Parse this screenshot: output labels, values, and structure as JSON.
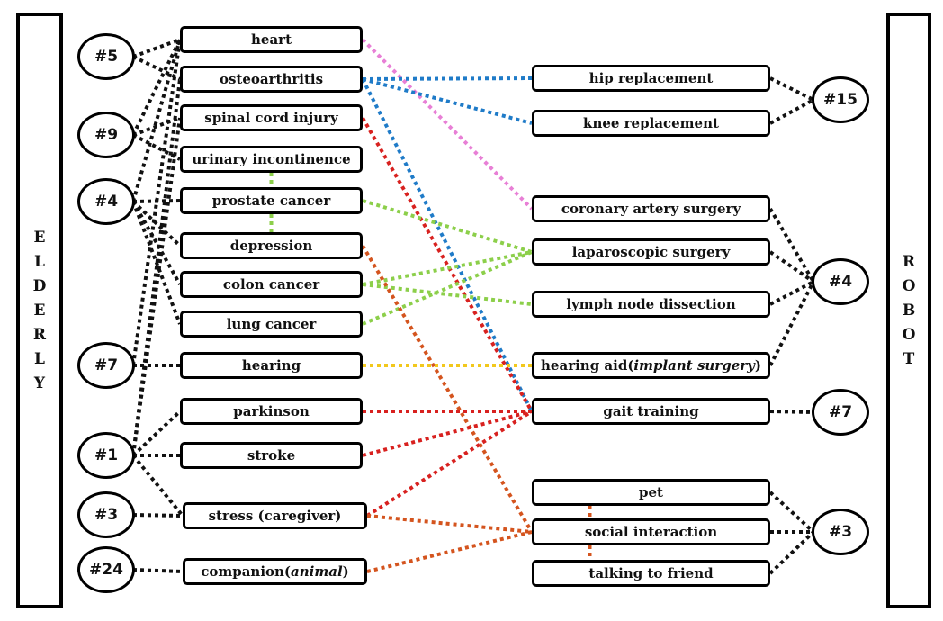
{
  "sidebars": {
    "left": {
      "label": "ELDERLY",
      "letters": [
        "E",
        "L",
        "D",
        "E",
        "R",
        "L",
        "Y"
      ]
    },
    "right": {
      "label": "ROBOT",
      "letters": [
        "R",
        "O",
        "B",
        "O",
        "T"
      ]
    }
  },
  "colors": {
    "black": "#111111",
    "pink": "#e87fd6",
    "blue": "#1f7bc8",
    "red": "#d8211f",
    "green": "#8ccf4a",
    "yellow": "#f2c81c",
    "orange": "#d4541e"
  },
  "left_counts": [
    {
      "id": "c5",
      "label": "#5"
    },
    {
      "id": "c9",
      "label": "#9"
    },
    {
      "id": "c4",
      "label": "#4"
    },
    {
      "id": "c7",
      "label": "#7"
    },
    {
      "id": "c1",
      "label": "#1"
    },
    {
      "id": "c3",
      "label": "#3"
    },
    {
      "id": "c24",
      "label": "#24"
    }
  ],
  "conditions": [
    {
      "id": "heart",
      "label": "heart"
    },
    {
      "id": "osteo",
      "label": "osteoarthritis"
    },
    {
      "id": "spinal",
      "label": "spinal cord injury"
    },
    {
      "id": "urinary",
      "label": "urinary incontinence"
    },
    {
      "id": "prostate",
      "label": "prostate cancer"
    },
    {
      "id": "depression",
      "label": "depression"
    },
    {
      "id": "colon",
      "label": "colon cancer"
    },
    {
      "id": "lung",
      "label": "lung cancer"
    },
    {
      "id": "hearing",
      "label": "hearing"
    },
    {
      "id": "parkinson",
      "label": "parkinson"
    },
    {
      "id": "stroke",
      "label": "stroke"
    },
    {
      "id": "stress",
      "label": "stress (caregiver)"
    },
    {
      "id": "companion",
      "label": "companion(",
      "label_italic": "animal",
      "label_suffix": ")"
    }
  ],
  "robot_apps": [
    {
      "id": "hip",
      "label": "hip replacement"
    },
    {
      "id": "knee",
      "label": "knee replacement"
    },
    {
      "id": "coronary",
      "label": "coronary artery surgery"
    },
    {
      "id": "lap",
      "label": "laparoscopic surgery"
    },
    {
      "id": "lymph",
      "label": "lymph node dissection"
    },
    {
      "id": "hearaid",
      "label": "hearing aid(",
      "label_italic": "implant surgery",
      "label_suffix": ")"
    },
    {
      "id": "gait",
      "label": "gait training"
    },
    {
      "id": "pet",
      "label": "pet"
    },
    {
      "id": "social",
      "label": "social interaction"
    },
    {
      "id": "talking",
      "label": "talking to friend"
    }
  ],
  "right_counts": [
    {
      "id": "r15",
      "label": "#15"
    },
    {
      "id": "r4",
      "label": "#4"
    },
    {
      "id": "r7",
      "label": "#7"
    },
    {
      "id": "r3",
      "label": "#3"
    }
  ],
  "edges": [
    {
      "from": "c5",
      "to": "heart",
      "color": "black"
    },
    {
      "from": "c5",
      "to": "osteo",
      "color": "black"
    },
    {
      "from": "c9",
      "to": "spinal",
      "color": "black"
    },
    {
      "from": "c9",
      "to": "urinary",
      "color": "black"
    },
    {
      "from": "c9",
      "to": "heart",
      "color": "black"
    },
    {
      "from": "c4",
      "to": "prostate",
      "color": "black"
    },
    {
      "from": "c4",
      "to": "depression",
      "color": "black"
    },
    {
      "from": "c4",
      "to": "colon",
      "color": "black"
    },
    {
      "from": "c4",
      "to": "lung",
      "color": "black"
    },
    {
      "from": "c4",
      "to": "heart",
      "color": "black"
    },
    {
      "from": "c7",
      "to": "hearing",
      "color": "black"
    },
    {
      "from": "c7",
      "to": "heart",
      "color": "black"
    },
    {
      "from": "c1",
      "to": "parkinson",
      "color": "black"
    },
    {
      "from": "c1",
      "to": "stroke",
      "color": "black"
    },
    {
      "from": "c1",
      "to": "stress",
      "color": "black"
    },
    {
      "from": "c1",
      "to": "osteo",
      "color": "black"
    },
    {
      "from": "c1",
      "to": "spinal",
      "color": "black"
    },
    {
      "from": "c3",
      "to": "stress",
      "color": "black"
    },
    {
      "from": "c24",
      "to": "companion",
      "color": "black"
    },
    {
      "from": "heart",
      "to": "coronary",
      "color": "pink"
    },
    {
      "from": "osteo",
      "to": "hip",
      "color": "blue"
    },
    {
      "from": "osteo",
      "to": "knee",
      "color": "blue"
    },
    {
      "from": "osteo",
      "to": "gait",
      "color": "blue"
    },
    {
      "from": "spinal",
      "to": "gait",
      "color": "red"
    },
    {
      "from": "urinary",
      "to": "prostate",
      "color": "green",
      "vertical": true
    },
    {
      "from": "prostate",
      "to": "depression",
      "color": "green",
      "vertical": true
    },
    {
      "from": "prostate",
      "to": "lap",
      "color": "green"
    },
    {
      "from": "colon",
      "to": "lap",
      "color": "green"
    },
    {
      "from": "colon",
      "to": "lymph",
      "color": "green"
    },
    {
      "from": "lung",
      "to": "lap",
      "color": "green"
    },
    {
      "from": "depression",
      "to": "social",
      "color": "orange"
    },
    {
      "from": "hearing",
      "to": "hearaid",
      "color": "yellow"
    },
    {
      "from": "parkinson",
      "to": "gait",
      "color": "red"
    },
    {
      "from": "stroke",
      "to": "gait",
      "color": "red"
    },
    {
      "from": "stress",
      "to": "gait",
      "color": "red"
    },
    {
      "from": "stress",
      "to": "social",
      "color": "orange"
    },
    {
      "from": "companion",
      "to": "social",
      "color": "orange"
    },
    {
      "from": "pet",
      "to": "social",
      "color": "orange",
      "vertical": true
    },
    {
      "from": "social",
      "to": "talking",
      "color": "orange",
      "vertical": true
    },
    {
      "from": "hip",
      "to": "r15",
      "color": "black"
    },
    {
      "from": "knee",
      "to": "r15",
      "color": "black"
    },
    {
      "from": "coronary",
      "to": "r4",
      "color": "black"
    },
    {
      "from": "lap",
      "to": "r4",
      "color": "black"
    },
    {
      "from": "lymph",
      "to": "r4",
      "color": "black"
    },
    {
      "from": "hearaid",
      "to": "r4",
      "color": "black"
    },
    {
      "from": "gait",
      "to": "r7",
      "color": "black"
    },
    {
      "from": "pet",
      "to": "r3",
      "color": "black"
    },
    {
      "from": "social",
      "to": "r3",
      "color": "black"
    },
    {
      "from": "talking",
      "to": "r3",
      "color": "black"
    }
  ]
}
